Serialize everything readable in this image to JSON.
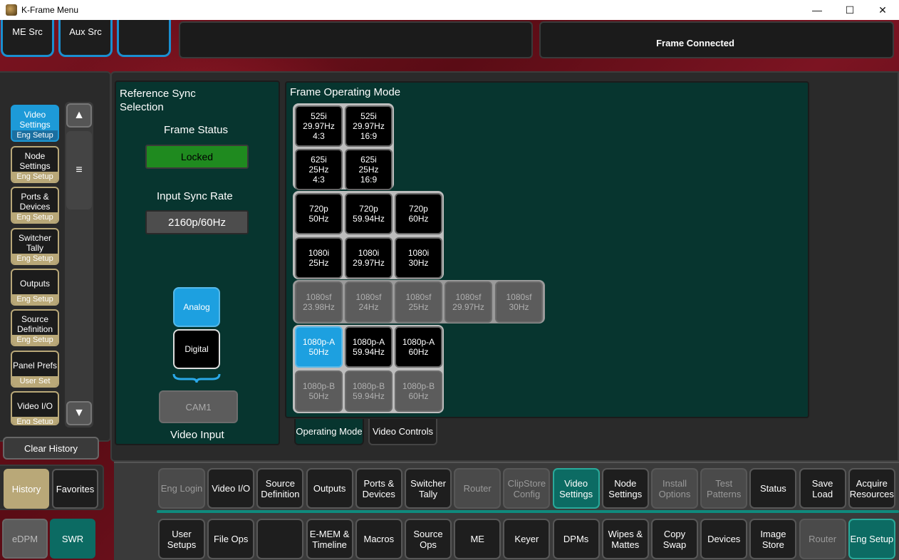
{
  "window": {
    "title": "K-Frame Menu",
    "minimize": "—",
    "maximize": "☐",
    "close": "✕"
  },
  "top": {
    "me_src": "ME Src",
    "aux_src": "Aux Src",
    "blank": "",
    "frame_status_msg": "Frame Connected"
  },
  "leftnav": {
    "items": [
      {
        "label": "Video Settings",
        "sub": "Eng Setup",
        "active": true
      },
      {
        "label": "Node Settings",
        "sub": "Eng Setup"
      },
      {
        "label": "Ports & Devices",
        "sub": "Eng Setup"
      },
      {
        "label": "Switcher Tally",
        "sub": "Eng Setup"
      },
      {
        "label": "Outputs",
        "sub": "Eng Setup"
      },
      {
        "label": "Source Definition",
        "sub": "Eng Setup"
      },
      {
        "label": "Panel Prefs",
        "sub": "User Set"
      },
      {
        "label": "Video I/O",
        "sub": "Eng Setup"
      }
    ],
    "scroll_up": "▲",
    "scroll_down": "▼",
    "scroll_thumb": "≡",
    "clear_history": "Clear History",
    "history": "History",
    "favorites": "Favorites",
    "edpm": "eDPM",
    "swr": "SWR"
  },
  "refsync": {
    "title": "Reference Sync Selection",
    "frame_status_label": "Frame Status",
    "frame_status_value": "Locked",
    "input_sync_label": "Input Sync Rate",
    "input_sync_value": "2160p/60Hz",
    "analog": "Analog",
    "digital": "Digital",
    "cam": "CAM1",
    "video_input": "Video Input"
  },
  "opmode": {
    "title": "Frame Operating Mode",
    "rows": [
      [
        {
          "l": "525i\n29.97Hz\n4:3"
        },
        {
          "l": "525i\n29.97Hz\n16:9"
        }
      ],
      [
        {
          "l": "625i\n25Hz\n4:3"
        },
        {
          "l": "625i\n25Hz\n16:9"
        }
      ],
      [
        {
          "l": "720p\n50Hz"
        },
        {
          "l": "720p\n59.94Hz"
        },
        {
          "l": "720p\n60Hz"
        }
      ],
      [
        {
          "l": "1080i\n25Hz"
        },
        {
          "l": "1080i\n29.97Hz"
        },
        {
          "l": "1080i\n30Hz"
        }
      ],
      [
        {
          "l": "1080sf\n23.98Hz",
          "dim": true
        },
        {
          "l": "1080sf\n24Hz",
          "dim": true
        },
        {
          "l": "1080sf\n25Hz",
          "dim": true
        },
        {
          "l": "1080sf\n29.97Hz",
          "dim": true
        },
        {
          "l": "1080sf\n30Hz",
          "dim": true
        }
      ],
      [
        {
          "l": "1080p-A\n50Hz",
          "sel": true
        },
        {
          "l": "1080p-A\n59.94Hz"
        },
        {
          "l": "1080p-A\n60Hz"
        }
      ],
      [
        {
          "l": "1080p-B\n50Hz",
          "dim": true
        },
        {
          "l": "1080p-B\n59.94Hz",
          "dim": true
        },
        {
          "l": "1080p-B\n60Hz",
          "dim": true
        }
      ]
    ],
    "tab_operating": "Operating Mode",
    "tab_video_controls": "Video Controls"
  },
  "bottom_row1": [
    {
      "label": "Eng Login",
      "state": "dis"
    },
    {
      "label": "Video I/O"
    },
    {
      "label": "Source Definition"
    },
    {
      "label": "Outputs"
    },
    {
      "label": "Ports & Devices"
    },
    {
      "label": "Switcher Tally"
    },
    {
      "label": "Router",
      "state": "dis"
    },
    {
      "label": "ClipStore Config",
      "state": "dis"
    },
    {
      "label": "Video Settings",
      "state": "on"
    },
    {
      "label": "Node Settings"
    },
    {
      "label": "Install Options",
      "state": "dis"
    },
    {
      "label": "Test Patterns",
      "state": "dis"
    },
    {
      "label": "Status"
    },
    {
      "label": "Save Load"
    },
    {
      "label": "Acquire Resources"
    }
  ],
  "bottom_row2": [
    {
      "label": "User Setups"
    },
    {
      "label": "File Ops"
    },
    {
      "label": ""
    },
    {
      "label": "E-MEM & Timeline"
    },
    {
      "label": "Macros"
    },
    {
      "label": "Source Ops"
    },
    {
      "label": "ME"
    },
    {
      "label": "Keyer"
    },
    {
      "label": "DPMs"
    },
    {
      "label": "Wipes & Mattes"
    },
    {
      "label": "Copy Swap"
    },
    {
      "label": "Devices"
    },
    {
      "label": "Image Store"
    },
    {
      "label": "Router",
      "state": "dis"
    },
    {
      "label": "Eng Setup",
      "state": "on"
    }
  ]
}
